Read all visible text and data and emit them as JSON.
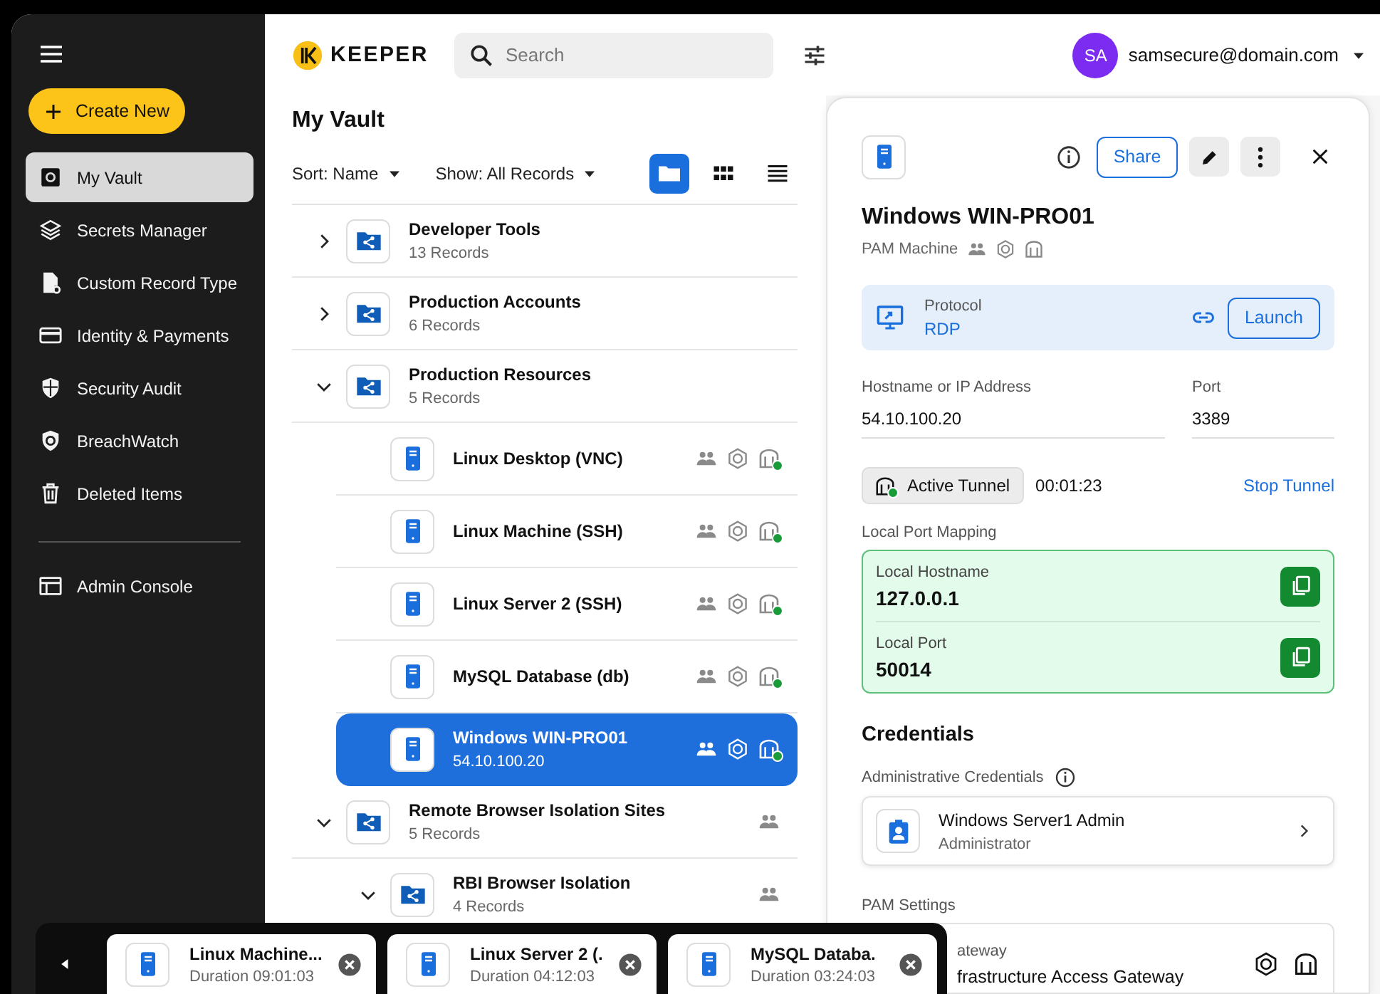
{
  "sidebar": {
    "create_button": "Create New",
    "items": [
      {
        "label": "My Vault",
        "kind": "vault",
        "selected": true
      },
      {
        "label": "Secrets Manager",
        "kind": "layers",
        "selected": false
      },
      {
        "label": "Custom Record Type",
        "kind": "doc",
        "selected": false
      },
      {
        "label": "Identity & Payments",
        "kind": "card",
        "selected": false
      },
      {
        "label": "Security Audit",
        "kind": "shield",
        "selected": false
      },
      {
        "label": "BreachWatch",
        "kind": "watch",
        "selected": false
      },
      {
        "label": "Deleted Items",
        "kind": "trash",
        "selected": false
      }
    ],
    "footer_items": [
      {
        "label": "Admin Console",
        "kind": "console",
        "selected": false
      }
    ]
  },
  "header": {
    "logo": "KEEPER",
    "search": {
      "placeholder": "Search"
    },
    "user": {
      "initials": "SA",
      "email": "samsecure@domain.com"
    }
  },
  "vault": {
    "title": "My Vault",
    "sort": "Sort: Name",
    "show": "Show: All Records",
    "views": [
      {
        "kind": "folder",
        "selected": true
      },
      {
        "kind": "grid",
        "selected": false
      },
      {
        "kind": "list",
        "selected": false
      }
    ],
    "tree": [
      {
        "kind": "folder",
        "name": "Developer Tools",
        "sub": "13 Records",
        "expanded": false,
        "selected": false,
        "shared": false
      },
      {
        "kind": "folder",
        "name": "Production Accounts",
        "sub": "6 Records",
        "expanded": false,
        "selected": false,
        "shared": false
      },
      {
        "kind": "folder",
        "name": "Production Resources",
        "sub": "5 Records",
        "expanded": true,
        "selected": false,
        "shared": false,
        "children": [
          {
            "kind": "record",
            "name": "Linux Desktop (VNC)",
            "selected": false,
            "shared": true,
            "pam": true,
            "tunnel_active": true
          },
          {
            "kind": "record",
            "name": "Linux Machine (SSH)",
            "selected": false,
            "shared": true,
            "pam": true,
            "tunnel_active": true
          },
          {
            "kind": "record",
            "name": "Linux Server 2 (SSH)",
            "selected": false,
            "shared": true,
            "pam": true,
            "tunnel_active": true
          },
          {
            "kind": "record",
            "name": "MySQL Database (db)",
            "selected": false,
            "shared": true,
            "pam": true,
            "tunnel_active": true
          },
          {
            "kind": "record",
            "name": "Windows WIN-PRO01",
            "sub": "54.10.100.20",
            "selected": true,
            "shared": true,
            "pam": true,
            "tunnel_active": true
          }
        ]
      },
      {
        "kind": "folder",
        "name": "Remote Browser Isolation Sites",
        "sub": "5 Records",
        "expanded": true,
        "selected": false,
        "shared": true,
        "children": [
          {
            "kind": "folder",
            "name": "RBI Browser Isolation",
            "sub": "4 Records",
            "expanded": true,
            "selected": false,
            "shared": true
          }
        ]
      }
    ]
  },
  "detail": {
    "title": "Windows WIN-PRO01",
    "type": "PAM Machine",
    "share_button": "Share",
    "protocol": {
      "label": "Protocol",
      "value": "RDP",
      "launch_button": "Launch"
    },
    "fields": [
      {
        "label": "Hostname or IP Address",
        "value": "54.10.100.20"
      },
      {
        "label": "Port",
        "value": "3389"
      }
    ],
    "tunnel": {
      "label": "Active Tunnel",
      "active": true,
      "time": "00:01:23",
      "stop": "Stop Tunnel"
    },
    "port_mapping": {
      "title": "Local Port Mapping",
      "rows": [
        {
          "label": "Local Hostname",
          "value": "127.0.0.1"
        },
        {
          "label": "Local Port",
          "value": "50014"
        }
      ]
    },
    "credentials": {
      "title": "Credentials",
      "subtitle": "Administrative Credentials",
      "item": {
        "name": "Windows Server1 Admin",
        "role": "Administrator"
      }
    },
    "pam_settings": {
      "title": "PAM Settings",
      "gateway_label": "ateway",
      "gateway_value": "frastructure Access Gateway"
    }
  },
  "sessions": [
    {
      "name": "Linux Machine...",
      "duration": "Duration 09:01:03"
    },
    {
      "name": "Linux Server 2 (.",
      "duration": "Duration 04:12:03"
    },
    {
      "name": "MySQL Databa.",
      "duration": "Duration 03:24:03"
    }
  ]
}
